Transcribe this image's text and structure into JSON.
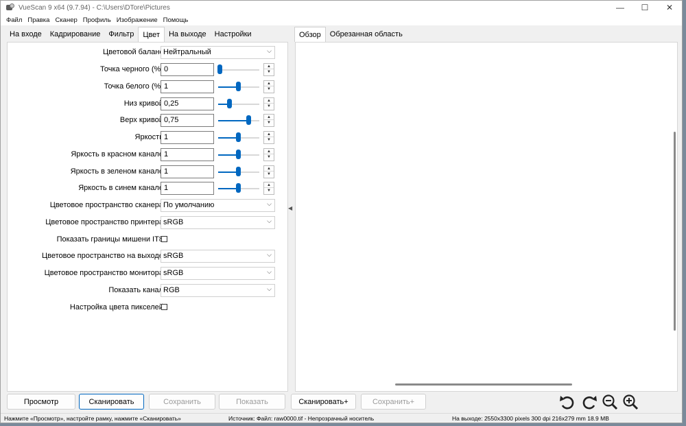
{
  "window": {
    "title": "VueScan 9 x64 (9.7.94) - C:\\Users\\DTore\\Pictures",
    "controls": [
      "—",
      "☐",
      "✕"
    ]
  },
  "menu": [
    "Файл",
    "Правка",
    "Сканер",
    "Профиль",
    "Изображение",
    "Помощь"
  ],
  "tabs_left": [
    "На входе",
    "Кадрирование",
    "Фильтр",
    "Цвет",
    "На выходе",
    "Настройки"
  ],
  "tabs_right": [
    "Обзор",
    "Обрезанная область"
  ],
  "color_settings": {
    "color_balance": {
      "label": "Цветовой баланс:",
      "value": "Нейтральный"
    },
    "black_point": {
      "label": "Точка черного (%):",
      "value": "0",
      "slider": 0.03
    },
    "white_point": {
      "label": "Точка белого (%):",
      "value": "1",
      "slider": 0.48
    },
    "curve_low": {
      "label": "Низ кривой:",
      "value": "0,25",
      "slider": 0.27
    },
    "curve_high": {
      "label": "Верх кривой:",
      "value": "0,75",
      "slider": 0.73
    },
    "brightness": {
      "label": "Яркость:",
      "value": "1",
      "slider": 0.48
    },
    "red_brightness": {
      "label": "Яркость в красном канале:",
      "value": "1",
      "slider": 0.48
    },
    "green_brightness": {
      "label": "Яркость в зеленом канале:",
      "value": "1",
      "slider": 0.48
    },
    "blue_brightness": {
      "label": "Яркость в синем канале:",
      "value": "1",
      "slider": 0.48
    },
    "scanner_color_space": {
      "label": "Цветовое пространство сканера:",
      "value": "По умолчанию"
    },
    "printer_color_space": {
      "label": "Цветовое пространство принтера:",
      "value": "sRGB"
    },
    "show_it8": {
      "label": "Показать границы мишени IT8:"
    },
    "output_color_space": {
      "label": "Цветовое пространство на выходе:",
      "value": "sRGB"
    },
    "monitor_color_space": {
      "label": "Цветовое пространство монитора:",
      "value": "sRGB"
    },
    "show_channel": {
      "label": "Показать канал:",
      "value": "RGB"
    },
    "pixel_color_adjust": {
      "label": "Настройка цвета пикселей:"
    }
  },
  "buttons": {
    "preview": "Просмотр",
    "scan": "Сканировать",
    "save": "Сохранить",
    "show": "Показать",
    "scan_plus": "Сканировать+",
    "save_plus": "Сохранить+"
  },
  "status": {
    "hint": "Нажмите «Просмотр», настройте рамку, нажмите «Сканировать»",
    "source": "Источник: Файл: raw0000.tif - Непрозрачный носитель",
    "output": "На выходе: 2550x3300 pixels 300 dpi 216x279 mm 18.9 MB"
  },
  "accent_color": "#0067c0"
}
